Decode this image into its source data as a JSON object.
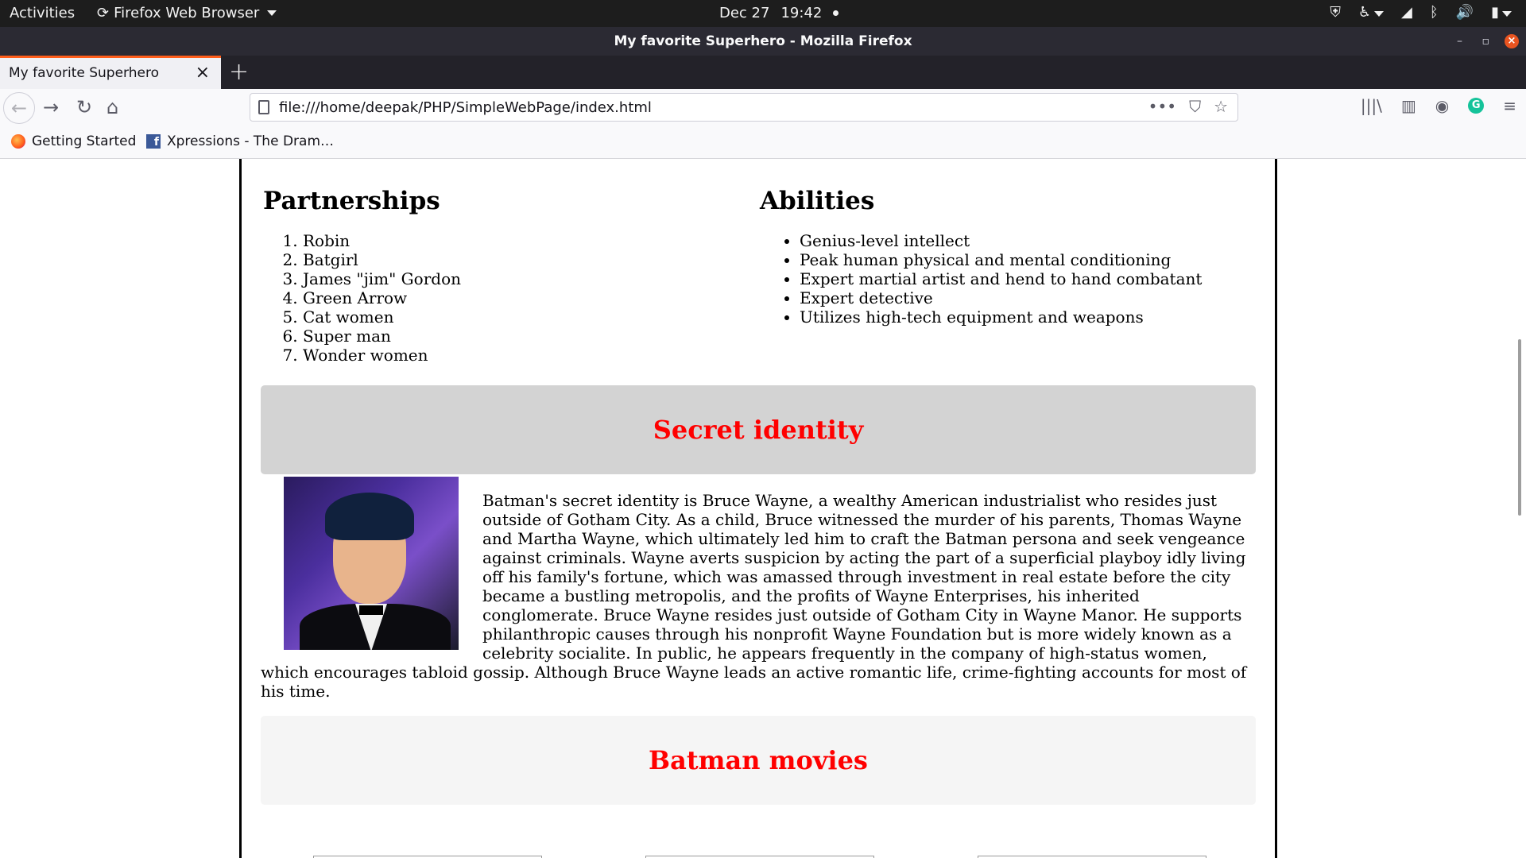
{
  "system_bar": {
    "activities": "Activities",
    "app_name": "Firefox Web Browser",
    "date": "Dec 27",
    "time": "19:42"
  },
  "window": {
    "title": "My favorite Superhero - Mozilla Firefox"
  },
  "tabs": [
    {
      "label": "My favorite Superhero",
      "active": true
    }
  ],
  "toolbar": {
    "url": "file:///home/deepak/PHP/SimpleWebPage/index.html"
  },
  "bookmarks": [
    {
      "label": "Getting Started",
      "icon": "firefox-icon"
    },
    {
      "label": "Xpressions - The Dram…",
      "icon": "facebook-icon"
    }
  ],
  "page": {
    "partnerships": {
      "heading": "Partnerships",
      "items": [
        "Robin",
        "Batgirl",
        "James \"jim\" Gordon",
        "Green Arrow",
        "Cat women",
        "Super man",
        "Wonder women"
      ]
    },
    "abilities": {
      "heading": "Abilities",
      "items": [
        "Genius-level intellect",
        "Peak human physical and mental conditioning",
        "Expert martial artist and hend to hand combatant",
        "Expert detective",
        "Utilizes high-tech equipment and weapons"
      ]
    },
    "secret_identity": {
      "heading": "Secret identity",
      "text": "Batman's secret identity is Bruce Wayne, a wealthy American industrialist who resides just outside of Gotham City. As a child, Bruce witnessed the murder of his parents, Thomas Wayne and Martha Wayne, which ultimately led him to craft the Batman persona and seek vengeance against criminals. Wayne averts suspicion by acting the part of a superficial playboy idly living off his family's fortune, which was amassed through investment in real estate before the city became a bustling metropolis, and the profits of Wayne Enterprises, his inherited conglomerate. Bruce Wayne resides just outside of Gotham City in Wayne Manor. He supports philanthropic causes through his nonprofit Wayne Foundation but is more widely known as a celebrity socialite. In public, he appears frequently in the company of high-status women, which encourages tabloid gossip. Although Bruce Wayne leads an active romantic life, crime-fighting accounts for most of his time."
    },
    "movies": {
      "heading": "Batman movies"
    },
    "colors": {
      "section_heading": "#ff0000",
      "secret_panel_bg": "#d3d3d3",
      "movies_panel_bg": "#f5f5f5",
      "tab_accent": "#ff5d1a"
    }
  }
}
